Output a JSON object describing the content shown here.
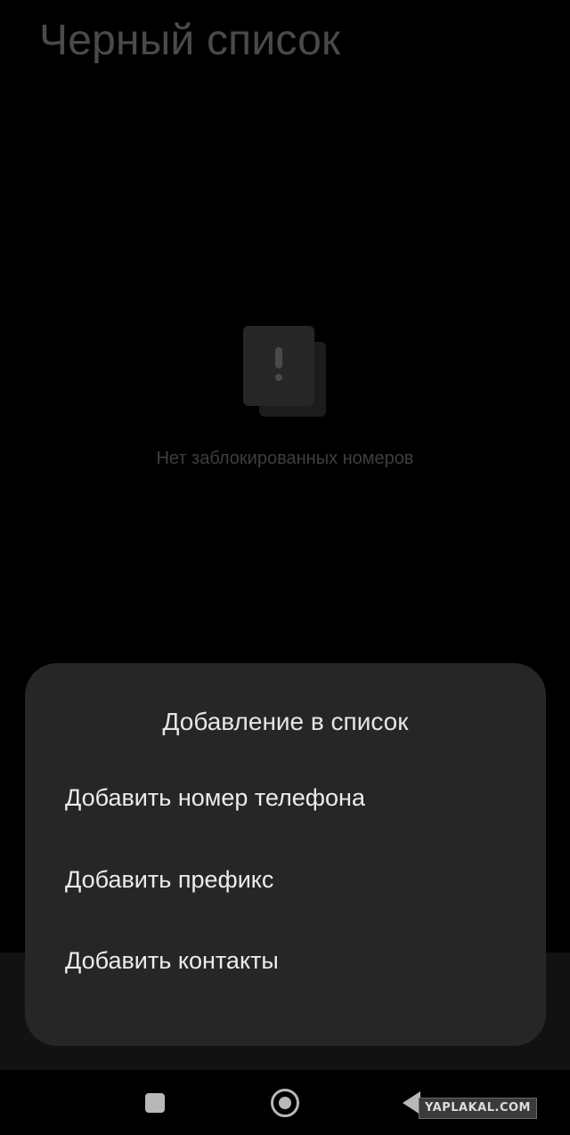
{
  "header": {
    "title": "Черный список"
  },
  "empty_state": {
    "icon": "exclamation-card-icon",
    "message": "Нет заблокированных номеров"
  },
  "sheet": {
    "title": "Добавление в список",
    "items": [
      {
        "label": "Добавить номер телефона"
      },
      {
        "label": "Добавить префикс"
      },
      {
        "label": "Добавить контакты"
      }
    ]
  },
  "nav_bar": {
    "icons": [
      "recents-square-icon",
      "home-circle-icon",
      "back-triangle-icon"
    ]
  },
  "watermark": "YAPLAKAL.COM",
  "colors": {
    "background": "#000000",
    "sheet": "#262626",
    "title_text": "#4a4a4a",
    "item_text": "#ececec"
  }
}
